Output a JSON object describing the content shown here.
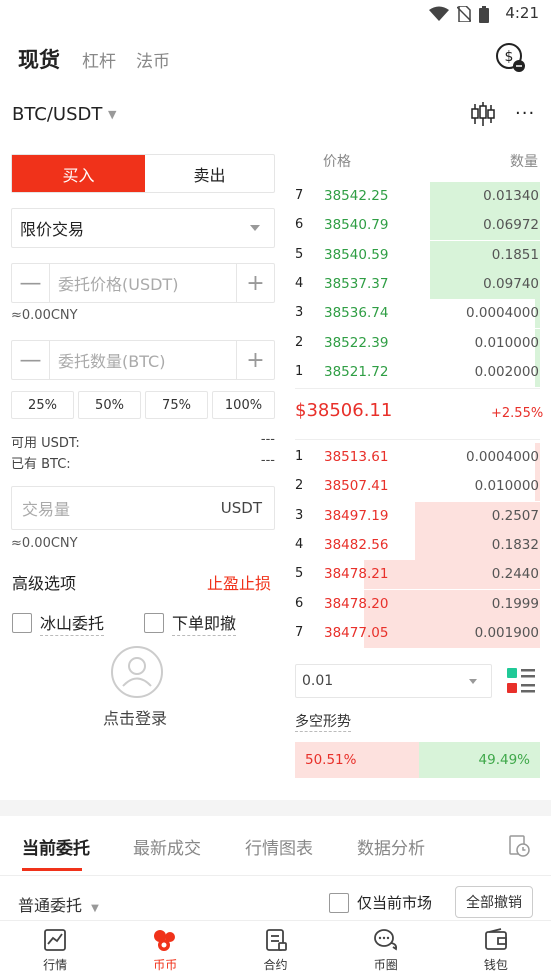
{
  "status_bar": {
    "time": "4:21"
  },
  "header": {
    "tabs": [
      {
        "label": "现货",
        "active": true
      },
      {
        "label": "杠杆",
        "active": false
      },
      {
        "label": "法币",
        "active": false
      }
    ]
  },
  "pair": {
    "label": "BTC/USDT"
  },
  "form": {
    "buy_label": "买入",
    "sell_label": "卖出",
    "order_type": "限价交易",
    "price_placeholder": "委托价格(USDT)",
    "price_cny": "≈0.00CNY",
    "amount_placeholder": "委托数量(BTC)",
    "percentages": [
      "25%",
      "50%",
      "75%",
      "100%"
    ],
    "available_label": "可用 USDT:",
    "available_value": "---",
    "held_label": "已有 BTC:",
    "held_value": "---",
    "volume_placeholder": "交易量",
    "volume_unit": "USDT",
    "volume_cny": "≈0.00CNY",
    "advanced_label": "高级选项",
    "stop_label": "止盈止损",
    "iceberg_label": "冰山委托",
    "ioc_label": "下单即撤",
    "login_label": "点击登录"
  },
  "orderbook": {
    "price_header": "价格",
    "qty_header": "数量",
    "asks": [
      {
        "idx": "7",
        "price": "38542.25",
        "qty": "0.01340",
        "depth": 0.45
      },
      {
        "idx": "6",
        "price": "38540.79",
        "qty": "0.06972",
        "depth": 0.45
      },
      {
        "idx": "5",
        "price": "38540.59",
        "qty": "0.1851",
        "depth": 0.45
      },
      {
        "idx": "4",
        "price": "38537.37",
        "qty": "0.09740",
        "depth": 0.45
      },
      {
        "idx": "3",
        "price": "38536.74",
        "qty": "0.0004000",
        "depth": 0.02
      },
      {
        "idx": "2",
        "price": "38522.39",
        "qty": "0.010000",
        "depth": 0.02
      },
      {
        "idx": "1",
        "price": "38521.72",
        "qty": "0.002000",
        "depth": 0.02
      }
    ],
    "last_price": "$38506.11",
    "change": "+2.55%",
    "bids": [
      {
        "idx": "1",
        "price": "38513.61",
        "qty": "0.0004000",
        "depth": 0.02
      },
      {
        "idx": "2",
        "price": "38507.41",
        "qty": "0.010000",
        "depth": 0.02
      },
      {
        "idx": "3",
        "price": "38497.19",
        "qty": "0.2507",
        "depth": 0.51
      },
      {
        "idx": "4",
        "price": "38482.56",
        "qty": "0.1832",
        "depth": 0.51
      },
      {
        "idx": "5",
        "price": "38478.21",
        "qty": "0.2440",
        "depth": 0.72
      },
      {
        "idx": "6",
        "price": "38478.20",
        "qty": "0.1999",
        "depth": 0.72
      },
      {
        "idx": "7",
        "price": "38477.05",
        "qty": "0.001900",
        "depth": 0.72
      }
    ],
    "depth_precision": "0.01",
    "trend_label": "多空形势",
    "long_pct": "50.51%",
    "short_pct": "49.49%",
    "long_fraction": 0.5051
  },
  "bottom_tabs": [
    {
      "label": "当前委托",
      "active": true
    },
    {
      "label": "最新成交",
      "active": false
    },
    {
      "label": "行情图表",
      "active": false
    },
    {
      "label": "数据分析",
      "active": false
    }
  ],
  "orders": {
    "filter_label": "普通委托",
    "current_market_label": "仅当前市场",
    "cancel_all_label": "全部撤销"
  },
  "navbar": [
    {
      "label": "行情",
      "icon": "chart-icon",
      "active": false
    },
    {
      "label": "币币",
      "icon": "coins-icon",
      "active": true
    },
    {
      "label": "合约",
      "icon": "contract-icon",
      "active": false
    },
    {
      "label": "币圈",
      "icon": "chat-icon",
      "active": false
    },
    {
      "label": "钱包",
      "icon": "wallet-icon",
      "active": false
    }
  ],
  "colors": {
    "brand_red": "#f0321a",
    "ask_green_bg": "#d8f3d9",
    "ask_green_text": "#2f9e44",
    "bid_red_bg": "#fde1de",
    "bid_red_text": "#e8302a"
  }
}
